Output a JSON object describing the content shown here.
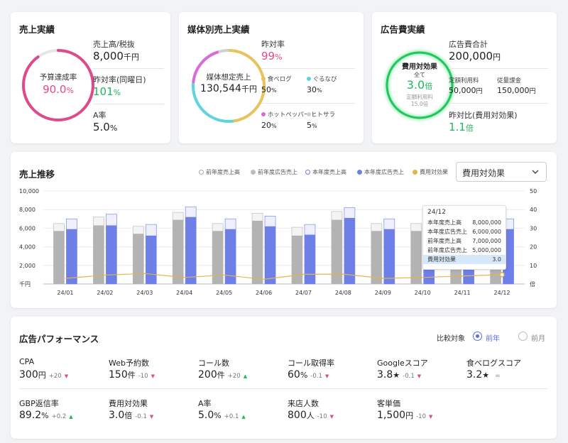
{
  "sales": {
    "title": "売上実績",
    "gauge_label": "予算達成率",
    "gauge_value": "90.0",
    "gauge_unit": "%",
    "gauge_fraction": 0.9,
    "rows": [
      {
        "label": "売上高/税抜",
        "value": "8,000",
        "unit": "千円"
      },
      {
        "label": "昨対率(同曜日)",
        "value": "101",
        "unit": "%"
      },
      {
        "label": "A率",
        "value": "5.0",
        "unit": "%"
      }
    ]
  },
  "media": {
    "title": "媒体別売上実績",
    "donut_label": "媒体想定売上",
    "donut_value": "130,544",
    "donut_unit": "千円",
    "yoy_label": "昨対率",
    "yoy_value": "99",
    "yoy_unit": "%",
    "segments": [
      {
        "name": "食べログ",
        "value": "50",
        "unit": "%",
        "color": "#e8c25a"
      },
      {
        "name": "ぐるなび",
        "value": "30",
        "unit": "%",
        "color": "#5fd3de"
      },
      {
        "name": "ホットペッパー",
        "value": "20",
        "unit": "%",
        "color": "#d86bd8"
      },
      {
        "name": "ヒトサラ",
        "value": "5",
        "unit": "%",
        "color": "#d0d0d0"
      }
    ]
  },
  "ad": {
    "title": "広告費実績",
    "gauge_label": "費用対効果",
    "gauge_sub": "全て",
    "gauge_value": "3.0",
    "gauge_unit": "倍",
    "gauge_note": "定額利用料",
    "gauge_note_value": "15.0倍",
    "total_label": "広告費合計",
    "total_value": "200,000",
    "total_unit": "円",
    "fixed_label": "定額利用料",
    "fixed_value": "50,000",
    "fixed_unit": "円",
    "usage_label": "従量課金",
    "usage_value": "150,000",
    "usage_unit": "円",
    "ratio_label": "昨対比(費用対効果)",
    "ratio_value": "1.1",
    "ratio_unit": "倍"
  },
  "trend": {
    "title": "売上推移",
    "legend": [
      {
        "label": "前年度売上高",
        "color": "#e0e0e0"
      },
      {
        "label": "前年度広告売上",
        "color": "#bdbdbd"
      },
      {
        "label": "本年度売上高",
        "color": "#e6eafb"
      },
      {
        "label": "本年度広告売上",
        "color": "#6f7fe8"
      },
      {
        "label": "費用対効果",
        "color": "#e2b54a"
      }
    ],
    "select_value": "費用対効果",
    "tooltip": {
      "title": "24/12",
      "rows": [
        {
          "label": "本年度売上高",
          "value": "8,000,000"
        },
        {
          "label": "本年度広告売上",
          "value": "6,000,000"
        },
        {
          "label": "前年度売上高",
          "value": "7,000,000"
        },
        {
          "label": "前年度広告売上",
          "value": "5,000,000"
        }
      ],
      "highlight": {
        "label": "費用対効果",
        "value": "3.0"
      }
    }
  },
  "chart_data": {
    "type": "bar",
    "categories": [
      "24/01",
      "24/02",
      "24/03",
      "24/04",
      "24/05",
      "24/06",
      "24/07",
      "24/08",
      "24/09",
      "24/10",
      "24/11",
      "24/12"
    ],
    "y_ticks": [
      "10,000",
      "8,000",
      "6,000",
      "4,000",
      "2,000",
      "千円"
    ],
    "y2_ticks": [
      "50",
      "40",
      "30",
      "20",
      "10",
      "倍"
    ],
    "ylim": [
      0,
      10000
    ],
    "y2lim": [
      0,
      50
    ],
    "series": [
      {
        "name": "前年度売上高",
        "values": [
          6500,
          7200,
          6200,
          7700,
          6500,
          7600,
          6100,
          7800,
          6500,
          6500,
          6500,
          6500
        ]
      },
      {
        "name": "前年度広告売上",
        "values": [
          5700,
          6300,
          5400,
          6900,
          5700,
          6800,
          5200,
          6900,
          5700,
          5700,
          5700,
          5700
        ]
      },
      {
        "name": "本年度売上高",
        "values": [
          7000,
          7500,
          6400,
          8300,
          7000,
          7300,
          6400,
          8200,
          7000,
          7000,
          7000,
          7000
        ]
      },
      {
        "name": "本年度広告売上",
        "values": [
          5900,
          6300,
          5200,
          7200,
          5900,
          6200,
          5300,
          7100,
          5900,
          5900,
          5900,
          5900
        ]
      },
      {
        "name": "費用対効果",
        "values": [
          3.0,
          4.8,
          5.6,
          3.5,
          4.8,
          2.5,
          5.2,
          5.3,
          3.0,
          3.5,
          4.3,
          5.0
        ]
      }
    ]
  },
  "performance": {
    "title": "広告パフォーマンス",
    "compare_label": "比較対象",
    "radio_prev_year": "前年",
    "radio_prev_month": "前月",
    "row1": [
      {
        "name": "CPA",
        "value": "300",
        "unit": "円",
        "delta": "+20",
        "dir": "down"
      },
      {
        "name": "Web予約数",
        "value": "150",
        "unit": "件",
        "delta": "-10",
        "dir": "down"
      },
      {
        "name": "コール数",
        "value": "200",
        "unit": "件",
        "delta": "+20",
        "dir": "up"
      },
      {
        "name": "コール取得率",
        "value": "60",
        "unit": "%",
        "delta": "-0.1",
        "dir": "down"
      },
      {
        "name": "Googleスコア",
        "value": "3.8",
        "unit": "★",
        "delta": "-0.1",
        "dir": "down"
      },
      {
        "name": "食べログスコア",
        "value": "3.2",
        "unit": "★",
        "delta": "",
        "dir": "eq"
      }
    ],
    "row2": [
      {
        "name": "GBP返信率",
        "value": "89.2",
        "unit": "%",
        "delta": "+0.2",
        "dir": "up"
      },
      {
        "name": "費用対効果",
        "value": "3.0",
        "unit": "倍",
        "delta": "-0.1",
        "dir": "down"
      },
      {
        "name": "A率",
        "value": "5.0",
        "unit": "%",
        "delta": "+0.1",
        "dir": "up"
      },
      {
        "name": "来店人数",
        "value": "800",
        "unit": "人",
        "delta": "-10",
        "dir": "down"
      },
      {
        "name": "客単価",
        "value": "1,500",
        "unit": "円",
        "delta": "-10",
        "dir": "down"
      }
    ],
    "arrow_up": "▲",
    "arrow_down": "▼",
    "equal_sign": "="
  },
  "icons": {
    "select": "chevron-down-icon",
    "radio": "radio-icon"
  },
  "colors": {
    "accent": "#5b6ee8",
    "positive": "#1fb85c",
    "negative": "#e0498a"
  }
}
